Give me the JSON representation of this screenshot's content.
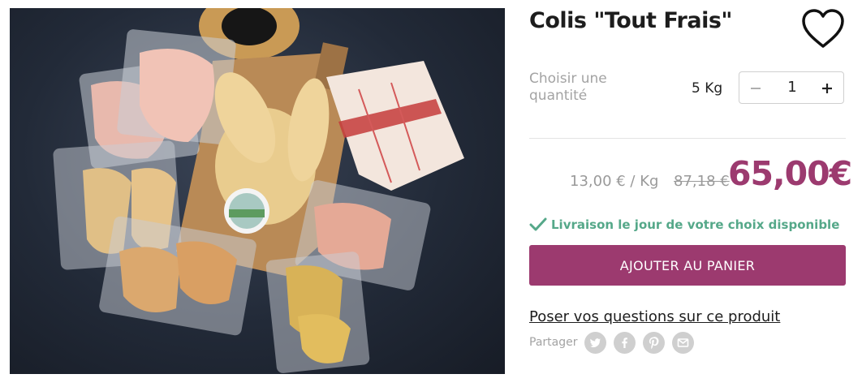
{
  "product": {
    "title": "Colis \"Tout Frais\"",
    "image_alt": "Colis de volailles sous vide sur planche en bois"
  },
  "favorite": {
    "icon": "heart-icon"
  },
  "quantity": {
    "label": "Choisir une quantité",
    "unit": "5 Kg",
    "value": "1",
    "minus_icon": "minus-icon",
    "plus_icon": "plus-icon"
  },
  "pricing": {
    "unit_price": "13,00 € / Kg",
    "old_price": "87,18 €",
    "price": "65,00€",
    "price_color": "#9c3a6f"
  },
  "delivery": {
    "text": "Livraison le jour de votre choix disponible",
    "icon": "checkmark-icon",
    "color": "#55a889"
  },
  "cart": {
    "label": "AJOUTER AU PANIER",
    "color": "#9c3a6f"
  },
  "ask": {
    "label": "Poser vos questions sur ce produit"
  },
  "share": {
    "label": "Partager",
    "icons": [
      "twitter-icon",
      "facebook-icon",
      "pinterest-icon",
      "email-icon"
    ]
  }
}
